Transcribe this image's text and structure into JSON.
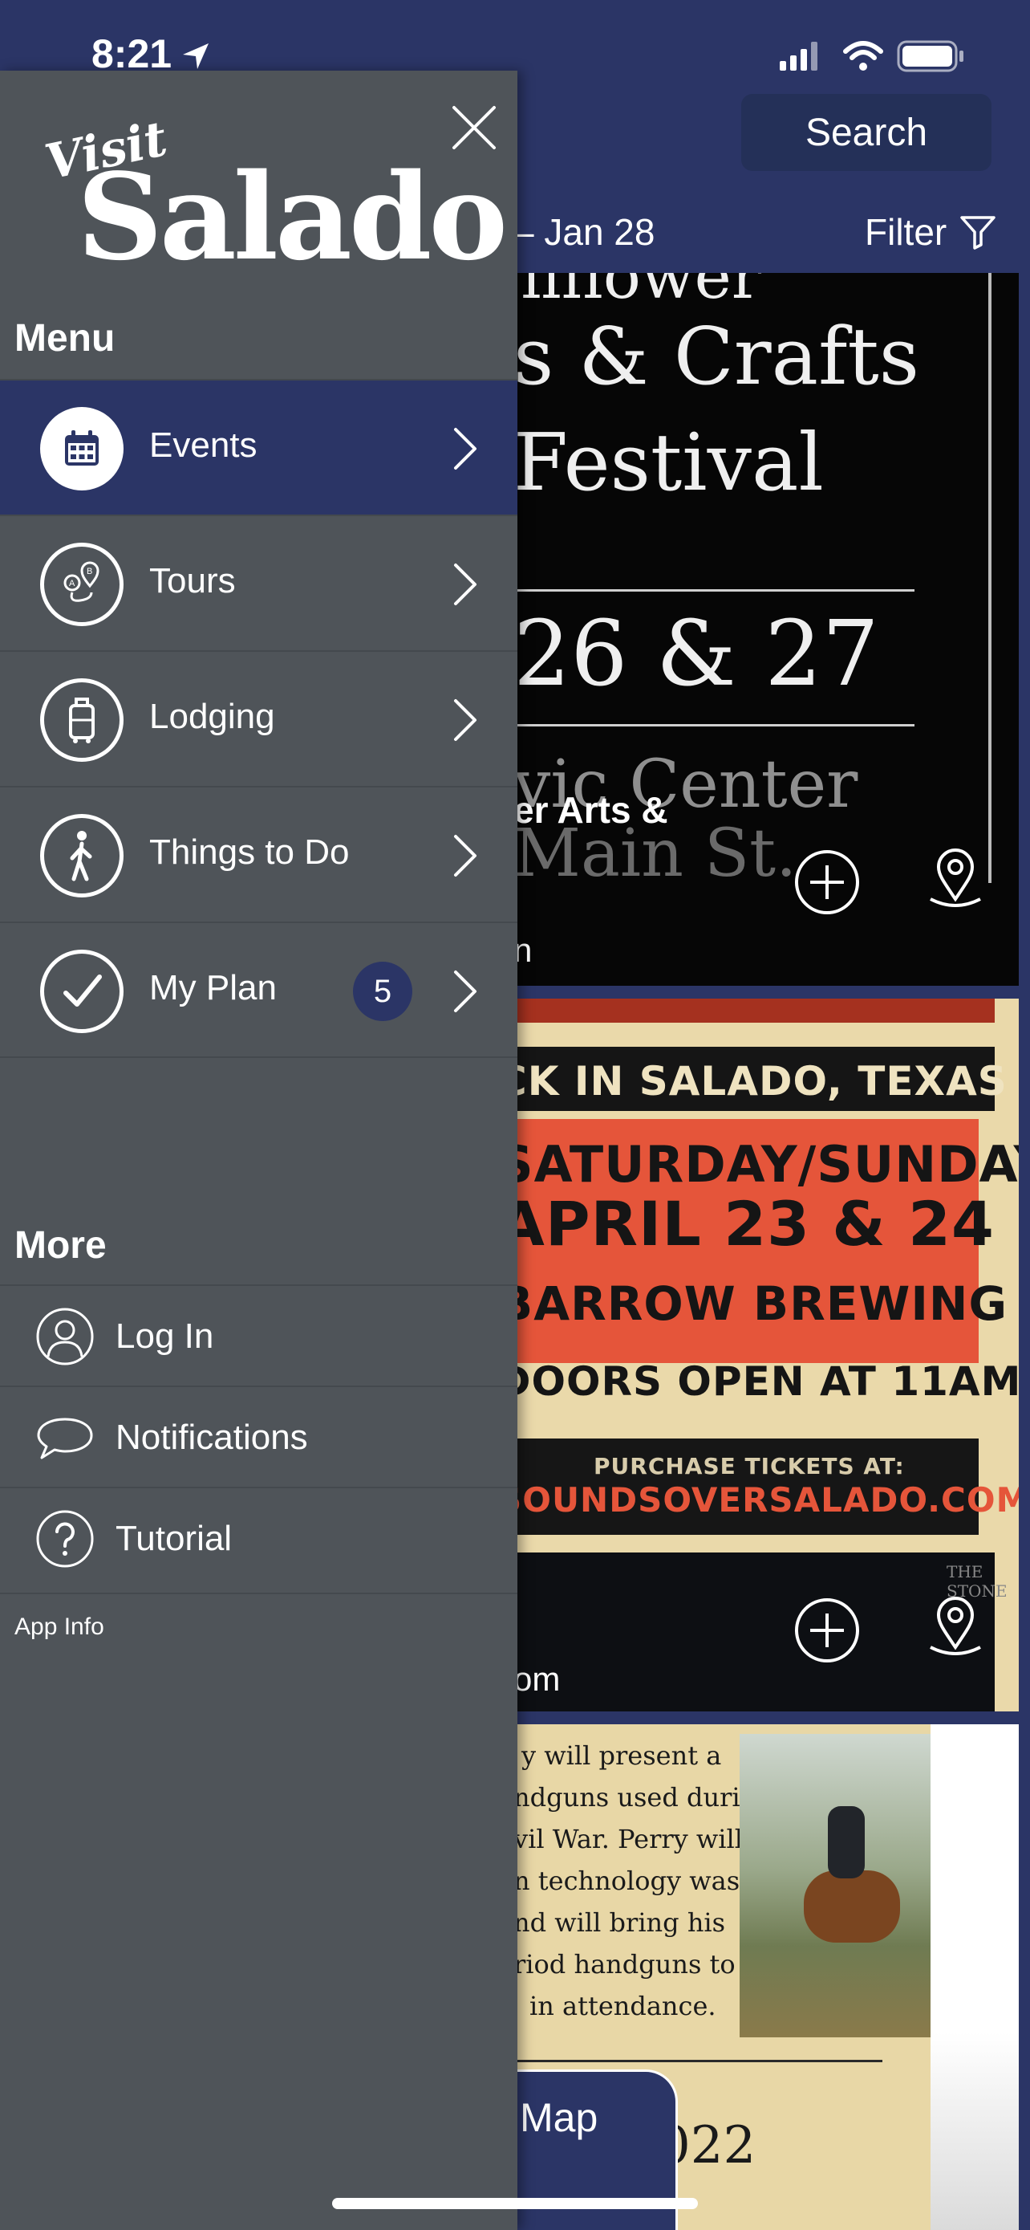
{
  "status_bar": {
    "time": "8:21"
  },
  "header": {
    "search_label": "Search"
  },
  "date_bar": {
    "date_range": "– Jan 28",
    "filter_label": "Filter"
  },
  "cards": [
    {
      "poster_lines": [
        "llflower",
        "s & Crafts",
        "Festival",
        "26 & 27",
        "vic Center",
        "Main St."
      ],
      "title_fragment": "er Arts &",
      "subtitle_fragment": "n"
    },
    {
      "poster_lines": [
        "CK IN SALADO, TEXAS",
        "SATURDAY/SUNDAY",
        "APRIL 23 & 24",
        "BARROW BREWING",
        "DOORS OPEN AT 11AM",
        "PURCHASE TICKETS AT:",
        "SOUNDSOVERSALADO.COM",
        "THE STONE"
      ],
      "subtitle_fragment": "om"
    },
    {
      "poster_lines": [
        "y will present a",
        "ndguns used during",
        "vil War. Perry will",
        "n technology was",
        "nd will bring his",
        "riod handguns to",
        "in attendance.",
        "022"
      ]
    }
  ],
  "view_map_label": "w Map",
  "drawer": {
    "logo_top": "Visit",
    "logo_main": "Salado",
    "menu_label": "Menu",
    "menu_items": [
      {
        "label": "Events",
        "icon": "calendar-icon"
      },
      {
        "label": "Tours",
        "icon": "tour-route-icon"
      },
      {
        "label": "Lodging",
        "icon": "luggage-icon"
      },
      {
        "label": "Things to Do",
        "icon": "walking-person-icon"
      },
      {
        "label": "My Plan",
        "icon": "checkmark-icon",
        "badge": "5"
      }
    ],
    "more_label": "More",
    "more_items": [
      {
        "label": "Log In",
        "icon": "user-icon"
      },
      {
        "label": "Notifications",
        "icon": "chat-bubble-icon"
      },
      {
        "label": "Tutorial",
        "icon": "question-icon"
      }
    ],
    "app_info": "App Info"
  },
  "colors": {
    "brand_navy": "#2b3566",
    "drawer_gray": "#4f5459"
  }
}
